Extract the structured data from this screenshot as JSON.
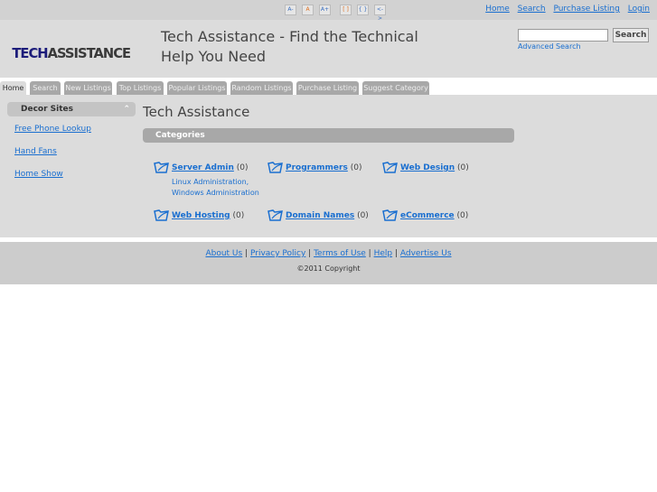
{
  "topbar": {
    "font_controls": [
      "A-",
      "A",
      "A+",
      "[ ]",
      "{ }",
      "<->"
    ],
    "links": [
      "Home",
      "Search",
      "Purchase Listing",
      "Login"
    ]
  },
  "header": {
    "logo_part1": "TECH",
    "logo_part2": "ASSISTANCE",
    "tagline": "Tech Assistance - Find the Technical Help You Need",
    "search_button": "Search",
    "advanced_search": "Advanced Search"
  },
  "tabs": [
    "Home",
    "Search",
    "New Listings",
    "Top Listings",
    "Popular Listings",
    "Random Listings",
    "Purchase Listing",
    "Suggest Category"
  ],
  "sidebar": {
    "title": "Decor Sites",
    "links": [
      "Free Phone Lookup",
      "Hand Fans",
      "Home Show"
    ]
  },
  "main": {
    "title": "Tech Assistance",
    "section": "Categories",
    "categories": [
      {
        "name": "Server Admin",
        "count": "(0)"
      },
      {
        "name": "Programmers",
        "count": "(0)"
      },
      {
        "name": "Web Design",
        "count": "(0)"
      },
      {
        "name": "Web Hosting",
        "count": "(0)"
      },
      {
        "name": "Domain Names",
        "count": "(0)"
      },
      {
        "name": "eCommerce",
        "count": "(0)"
      }
    ],
    "subcategories": [
      "Linux Administration,",
      "Windows Administration"
    ]
  },
  "footer": {
    "links": [
      "About Us",
      "Privacy Policy",
      "Terms of Use",
      "Help",
      "Advertise Us"
    ],
    "copyright": "©2011 Copyright"
  }
}
